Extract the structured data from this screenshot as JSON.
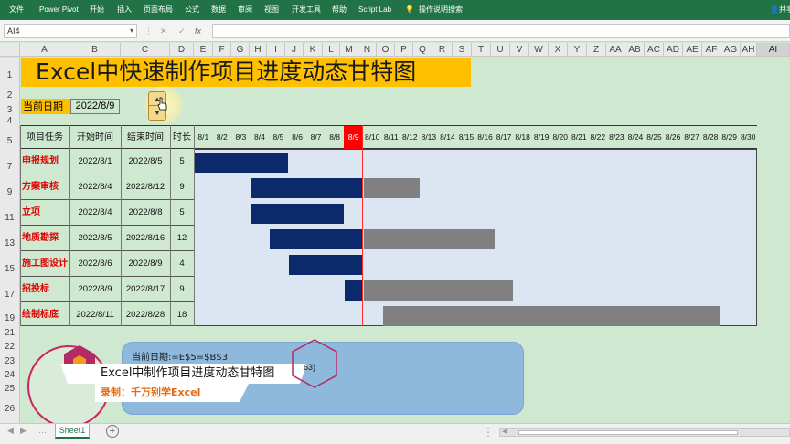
{
  "ribbon": {
    "tabs": [
      "文件",
      "Power Pivot",
      "开始",
      "插入",
      "页面布局",
      "公式",
      "数据",
      "审阅",
      "视图",
      "开发工具",
      "帮助",
      "Script Lab"
    ],
    "tell_me": "操作说明搜索",
    "share": "共享",
    "bg_color": "#217346"
  },
  "formula_bar": {
    "name_box": "AI4",
    "cancel": "✕",
    "enter": "✓",
    "fx": "fx",
    "value": ""
  },
  "columns": [
    "A",
    "B",
    "C",
    "D",
    "E",
    "F",
    "G",
    "H",
    "I",
    "J",
    "K",
    "L",
    "M",
    "N",
    "O",
    "P",
    "Q",
    "R",
    "S",
    "T",
    "U",
    "V",
    "W",
    "X",
    "Y",
    "Z",
    "AA",
    "AB",
    "AC",
    "AD",
    "AE",
    "AF",
    "AG",
    "AH",
    "AI"
  ],
  "rows": [
    "1",
    "2",
    "3",
    "4",
    "5",
    "7",
    "9",
    "11",
    "13",
    "15",
    "17",
    "19",
    "21",
    "22",
    "23",
    "24",
    "25",
    "26"
  ],
  "sheet": {
    "title": "Excel中快速制作项目进度动态甘特图",
    "current_date_label": "当前日期",
    "current_date_value": "2022/8/9",
    "headers": {
      "task": "项目任务",
      "start": "开始时间",
      "end": "结束时间",
      "dur": "时长"
    },
    "dates": [
      "8/1",
      "8/2",
      "8/3",
      "8/4",
      "8/5",
      "8/6",
      "8/7",
      "8/8",
      "8/9",
      "8/10",
      "8/11",
      "8/12",
      "8/13",
      "8/14",
      "8/15",
      "8/16",
      "8/17",
      "8/18",
      "8/19",
      "8/20",
      "8/21",
      "8/22",
      "8/23",
      "8/24",
      "8/25",
      "8/26",
      "8/27",
      "8/28",
      "8/29",
      "8/30"
    ],
    "today_index": 8,
    "tasks": [
      {
        "name": "申报规划",
        "start": "2022/8/1",
        "end": "2022/8/5",
        "dur": "5"
      },
      {
        "name": "方案审核",
        "start": "2022/8/4",
        "end": "2022/8/12",
        "dur": "9"
      },
      {
        "name": "立项",
        "start": "2022/8/4",
        "end": "2022/8/8",
        "dur": "5"
      },
      {
        "name": "地质勘探",
        "start": "2022/8/5",
        "end": "2022/8/16",
        "dur": "12"
      },
      {
        "name": "施工图设计",
        "start": "2022/8/6",
        "end": "2022/8/9",
        "dur": "4"
      },
      {
        "name": "招投标",
        "start": "2022/8/9",
        "end": "2022/8/17",
        "dur": "9"
      },
      {
        "name": "绘制标底",
        "start": "2022/8/11",
        "end": "2022/8/28",
        "dur": "18"
      }
    ],
    "colors": {
      "done": "#0b2a6b",
      "pending": "#808080",
      "today": "#ff0000",
      "header_fill": "#ffc000",
      "task_name": "#e00000"
    }
  },
  "overlay": {
    "formula_hint": "当前日期:=E$5=$B$3",
    "caption_title": "Excel中制作项目进度动态甘特图",
    "caption_sub": "录制：千万别学Excel",
    "badge_number": "63)"
  },
  "status": {
    "sheet_tab": "Sheet1",
    "add_sheet": "+"
  }
}
